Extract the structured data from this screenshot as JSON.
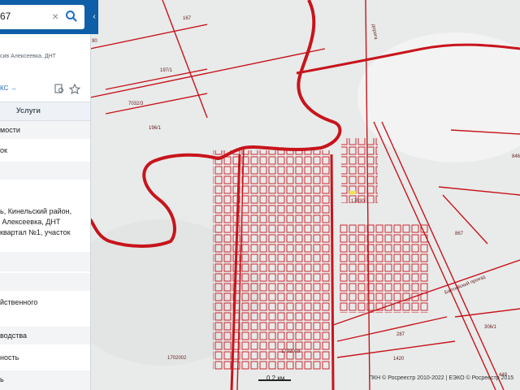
{
  "search": {
    "value": "67",
    "clear_icon": "close-icon",
    "button_icon": "search-icon"
  },
  "sidebar": {
    "description": "сив Алексеевка, ДНТ",
    "link_label": "КС →",
    "tab_services": "Услуги",
    "rows": [
      {
        "text": "мости"
      },
      {
        "text": "ок"
      },
      {
        "text": ""
      },
      {
        "text": ""
      },
      {
        "text": ""
      },
      {
        "text": "йственного"
      },
      {
        "text": "водства"
      },
      {
        "text": "ность"
      },
      {
        "text": "ь"
      }
    ],
    "address": "ь, Кинельский район,\n Алексеевка, ДНТ\nквартал №1, участок"
  },
  "map": {
    "parcel_labels": [
      "167",
      "197/1",
      "7032/3",
      "196/1",
      "90",
      "17030",
      "867",
      "846",
      "287",
      "1420",
      "306/1",
      "449",
      "1702002",
      "1702003",
      "дорога",
      "Балтийский проезд"
    ],
    "scale": "0,2 км",
    "copyright": "ПКН © Росреестр 2010-2022 | ЕЭКО © Росреестр 2015",
    "boundary_color": "#c8141c"
  }
}
